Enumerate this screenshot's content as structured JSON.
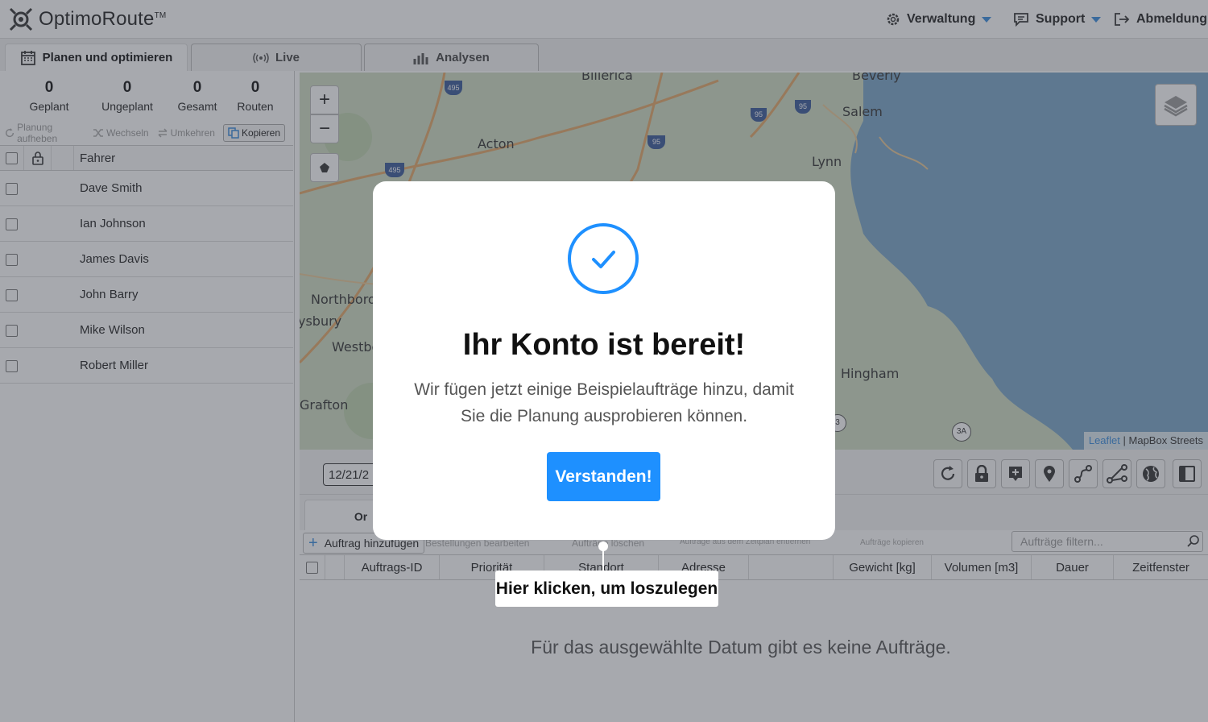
{
  "app": {
    "name": "OptimoRoute",
    "tm": "TM"
  },
  "header": {
    "admin": "Verwaltung",
    "support": "Support",
    "logout": "Abmeldung"
  },
  "tabs": [
    {
      "label": "Planen und optimieren"
    },
    {
      "label": "Live"
    },
    {
      "label": "Analysen"
    }
  ],
  "stats": [
    {
      "value": "0",
      "label": "Geplant"
    },
    {
      "value": "0",
      "label": "Ungeplant"
    },
    {
      "value": "0",
      "label": "Gesamt"
    },
    {
      "value": "0",
      "label": "Routen"
    }
  ],
  "left_toolbar": {
    "unplan": "Planung aufheben",
    "swap": "Wechseln",
    "reverse": "Umkehren",
    "copy": "Kopieren"
  },
  "drivers": {
    "column": "Fahrer",
    "items": [
      "Dave Smith",
      "Ian Johnson",
      "James Davis",
      "John Barry",
      "Mike Wilson",
      "Robert Miller"
    ]
  },
  "map": {
    "places": [
      "Billerica",
      "Beverly",
      "Salem",
      "Acton",
      "Lynn",
      "Northborou",
      "ysbury",
      "Westbo",
      "Hingham",
      "Grafton"
    ],
    "shields": [
      "495",
      "95",
      "95",
      "95",
      "495",
      "3A",
      "3"
    ],
    "attribution_link": "Leaflet",
    "attribution_text": "| MapBox Streets"
  },
  "date": {
    "value": "12/21/2"
  },
  "orders": {
    "tab_label": "Or",
    "add_label": "Auftrag hinzufügen",
    "edit_label": "Bestellungen bearbeiten",
    "delete_label": "Aufträge löschen",
    "remove_label": "Aufträge aus dem Zeitplan entfernen",
    "copy_label": "Aufträge kopieren",
    "filter_placeholder": "Aufträge filtern...",
    "columns": [
      "Auftrags-ID",
      "Priorität",
      "Standort",
      "Adresse",
      "Gewicht [kg]",
      "Volumen [m3]",
      "Dauer",
      "Zeitfenster"
    ],
    "empty": "Für das ausgewählte Datum gibt es keine Aufträge."
  },
  "modal": {
    "title": "Ihr Konto ist bereit!",
    "text": "Wir fügen jetzt einige Beispielaufträge hinzu, damit Sie die Planung ausprobieren können.",
    "button": "Verstanden!"
  },
  "tooltip": "Hier klicken, um loszulegen",
  "colors": {
    "accent": "#1e90ff",
    "water": "#7aa6c8",
    "land": "#cfdcc4",
    "overlay": "rgba(60,65,75,0.45)"
  }
}
